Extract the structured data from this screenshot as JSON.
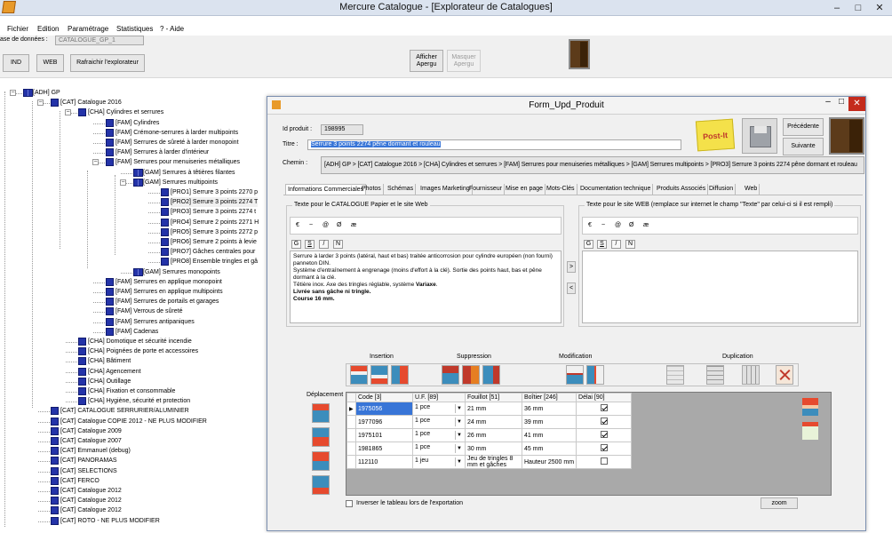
{
  "window": {
    "title": "Mercure Catalogue - [Explorateur de Catalogues]"
  },
  "menu": [
    "Fichier",
    "Edition",
    "Paramétrage",
    "Statistiques",
    "? - Aide"
  ],
  "db": {
    "label": "ase de données :",
    "value": "CATALOGUE_GP_1"
  },
  "toolbar": {
    "ind": "IND",
    "web": "WEB",
    "refresh": "Rafraichir l'explorateur",
    "show": "Afficher Apergu",
    "hide": "Masquer Apergu"
  },
  "tree": [
    {
      "d": 0,
      "t": "[ADH] GP"
    },
    {
      "d": 1,
      "t": "[CAT] Catalogue 2016"
    },
    {
      "d": 2,
      "t": "[CHA] Cylindres et serrures"
    },
    {
      "d": 3,
      "t": "[FAM] Cylindres"
    },
    {
      "d": 3,
      "t": "[FAM] Crémone-serrures à larder multipoints"
    },
    {
      "d": 3,
      "t": "[FAM] Serrures de sûreté à larder monopoint"
    },
    {
      "d": 3,
      "t": "[FAM] Serrures à larder d'intérieur"
    },
    {
      "d": 3,
      "t": "[FAM] Serrures pour menuiseries métalliques"
    },
    {
      "d": 4,
      "t": "[GAM] Serrures à têtières filantes"
    },
    {
      "d": 4,
      "t": "[GAM] Serrures multipoints"
    },
    {
      "d": 5,
      "t": "[PRO1] Serrure 3 points 2270 p"
    },
    {
      "d": 5,
      "t": "[PRO2] Serrure 3 points 2274 T"
    },
    {
      "d": 5,
      "t": "[PRO3] Serrure 3 points 2274 t"
    },
    {
      "d": 5,
      "t": "[PRO4] Serrure 2 points 2271 H"
    },
    {
      "d": 5,
      "t": "[PRO5] Serrure 3 points 2272 p"
    },
    {
      "d": 5,
      "t": "[PRO6] Serrure 2 points à levie"
    },
    {
      "d": 5,
      "t": "[PRO7] Gâches centrales pour"
    },
    {
      "d": 5,
      "t": "[PRO8] Ensemble tringles et gâ"
    },
    {
      "d": 4,
      "t": "[GAM] Serrures monopoints"
    },
    {
      "d": 3,
      "t": "[FAM] Serrures en applique monopoint"
    },
    {
      "d": 3,
      "t": "[FAM] Serrures en applique multipoints"
    },
    {
      "d": 3,
      "t": "[FAM] Serrures de portails et garages"
    },
    {
      "d": 3,
      "t": "[FAM] Verrous de sûreté"
    },
    {
      "d": 3,
      "t": "[FAM] Serrures antipaniques"
    },
    {
      "d": 3,
      "t": "[FAM] Cadenas"
    },
    {
      "d": 2,
      "t": "[CHA] Domotique et sécurité incendie"
    },
    {
      "d": 2,
      "t": "[CHA] Poignées de porte et accessoires"
    },
    {
      "d": 2,
      "t": "[CHA] Bâtiment"
    },
    {
      "d": 2,
      "t": "[CHA] Agencement"
    },
    {
      "d": 2,
      "t": "[CHA] Outillage"
    },
    {
      "d": 2,
      "t": "[CHA] Fixation et consommable"
    },
    {
      "d": 2,
      "t": "[CHA] Hygiène, sécurité et protection"
    },
    {
      "d": 1,
      "t": "[CAT] CATALOGUE SERRURIER/ALUMINIER"
    },
    {
      "d": 1,
      "t": "[CAT] Catalogue COPIE 2012 - NE PLUS MODIFIER"
    },
    {
      "d": 1,
      "t": "[CAT] Catalogue 2009"
    },
    {
      "d": 1,
      "t": "[CAT] Catalogue 2007"
    },
    {
      "d": 1,
      "t": "[CAT] Emmanuel (debug)"
    },
    {
      "d": 1,
      "t": "[CAT] PANORAMAS"
    },
    {
      "d": 1,
      "t": "[CAT] SELECTIONS"
    },
    {
      "d": 1,
      "t": "[CAT] FERCO"
    },
    {
      "d": 1,
      "t": "[CAT] Catalogue 2012"
    },
    {
      "d": 1,
      "t": "[CAT] Catalogue 2012"
    },
    {
      "d": 1,
      "t": "[CAT] Catalogue 2012"
    },
    {
      "d": 1,
      "t": "[CAT] ROTO - NE PLUS MODIFIER"
    }
  ],
  "form": {
    "title": "Form_Upd_Produit",
    "id_label": "Id produit :",
    "id_value": "198995",
    "titre_label": "Titre :",
    "titre_value": "Serrure 3 points 2274 pêne dormant et rouleau",
    "chemin_label": "Chemin :",
    "chemin_value": "[ADH] GP > [CAT] Catalogue 2016 > [CHA] Cylindres et serrures > [FAM] Serrures pour menuiseries métalliques > [GAM] Serrures multipoints > [PRO3] Serrure 3 points 2274 pêne dormant et rouleau",
    "postit": "Post-It",
    "prev": "Précédente",
    "next": "Suivante",
    "tabs": [
      "Informations Commerciales",
      "Photos",
      "Schémas",
      "Images Marketing",
      "Fournisseur",
      "Mise en page",
      "Mots-Clés",
      "Documentation technique",
      "Produits Associés",
      "Diffusion",
      "Web"
    ],
    "left_group": "Texte pour le CATALOGUE Papier et le site Web",
    "right_group": "Texte pour le site WEB (remplace sur internet le champ \"Texte\" par celui-ci si il est rempli)",
    "chars": [
      "€",
      "~",
      "@",
      "Ø",
      "æ"
    ],
    "fmt": [
      "G",
      "S",
      "/",
      "N"
    ],
    "text_lines": [
      "Serrure à larder 3 points (latéral, haut et bas) traitée anticorrosion pour cylindre européen (non fourni)",
      "panneton DIN.",
      "Système d'entraînement à engrenage (moins d'effort à la clé). Sortie des points haut, bas et pêne",
      "dormant à la clé.",
      "Têtière inox. Axe des tringles réglable, système "
    ],
    "text_bold_word": "Variaxe",
    "text_bold_lines": [
      "Livrée sans gâche ni tringle.",
      "Course 16 mm."
    ],
    "arrow_right": ">",
    "arrow_left": "<",
    "sections": {
      "insertion": "Insertion",
      "suppression": "Suppression",
      "modification": "Modification",
      "duplication": "Duplication"
    },
    "deplacement": "Déplacement",
    "grid": {
      "headers": [
        "Code [3]",
        "U.F. [89]",
        "Fouillot [51]",
        "Boîtier [246]",
        "Délai [90]"
      ],
      "rows": [
        {
          "code": "1975056",
          "uf": "1 pce",
          "fouillot": "21 mm",
          "boitier": "36 mm",
          "delai": true
        },
        {
          "code": "1977096",
          "uf": "1 pce",
          "fouillot": "24 mm",
          "boitier": "39 mm",
          "delai": true
        },
        {
          "code": "1975101",
          "uf": "1 pce",
          "fouillot": "26 mm",
          "boitier": "41 mm",
          "delai": true
        },
        {
          "code": "1981865",
          "uf": "1 pce",
          "fouillot": "30 mm",
          "boitier": "45 mm",
          "delai": true
        },
        {
          "code": "112110",
          "uf": "1 jeu",
          "fouillot": "Jeu de tringles 8 mm et gâches",
          "boitier": "Hauteur 2500 mm",
          "delai": false
        }
      ]
    },
    "invert_label": "Inverser le tableau lors de l'exportation",
    "zoom": "zoom"
  }
}
